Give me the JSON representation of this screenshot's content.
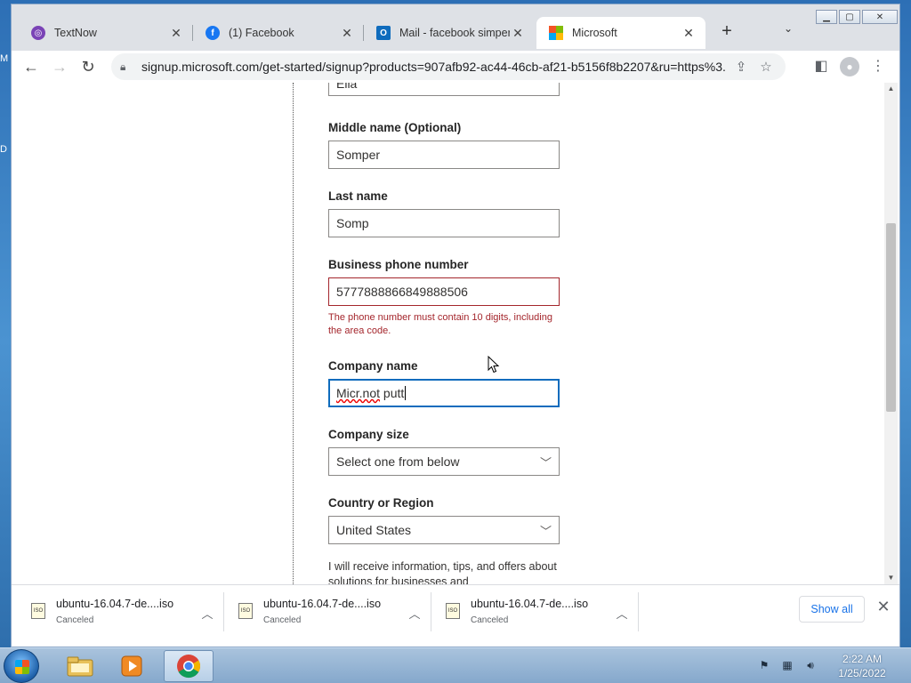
{
  "desktop": {
    "fragments": [
      "M",
      "D"
    ]
  },
  "window": {
    "tabs": [
      {
        "label": "TextNow",
        "icon": "textnow-icon",
        "color": "#7a43b6"
      },
      {
        "label": "(1) Facebook",
        "icon": "facebook-icon",
        "color": "#1877f2"
      },
      {
        "label": "Mail - facebook simper",
        "icon": "outlook-icon",
        "color": "#0f6cbd"
      },
      {
        "label": "Microsoft",
        "icon": "microsoft-icon",
        "color": "#f35325"
      }
    ],
    "new_tab_symbol": "+",
    "url": "signup.microsoft.com/get-started/signup?products=907afb92-ac44-46cb-af21-b5156f8b2207&ru=https%3..."
  },
  "form": {
    "first_name_value": "Ella",
    "middle_name_label": "Middle name (Optional)",
    "middle_name_value": "Somper",
    "last_name_label": "Last name",
    "last_name_value": "Somp",
    "phone_label": "Business phone number",
    "phone_value": "5777888866849888506",
    "phone_error": "The phone number must contain 10 digits, including the area code.",
    "company_name_label": "Company name",
    "company_name_value_part1": "Micr.not",
    "company_name_value_part2": " putt",
    "company_size_label": "Company size",
    "company_size_value": "Select one from below",
    "country_label": "Country or Region",
    "country_value": "United States",
    "consent_text": "I will receive information, tips, and offers about solutions for businesses and"
  },
  "downloads": {
    "items": [
      {
        "name": "ubuntu-16.04.7-de....iso",
        "status": "Canceled"
      },
      {
        "name": "ubuntu-16.04.7-de....iso",
        "status": "Canceled"
      },
      {
        "name": "ubuntu-16.04.7-de....iso",
        "status": "Canceled"
      }
    ],
    "show_all_label": "Show all"
  },
  "taskbar": {
    "clock_time": "2:22 AM",
    "clock_date": "1/25/2022"
  },
  "colors": {
    "error": "#a4262c",
    "focus": "#0f6cbd",
    "link": "#1a73e8"
  }
}
